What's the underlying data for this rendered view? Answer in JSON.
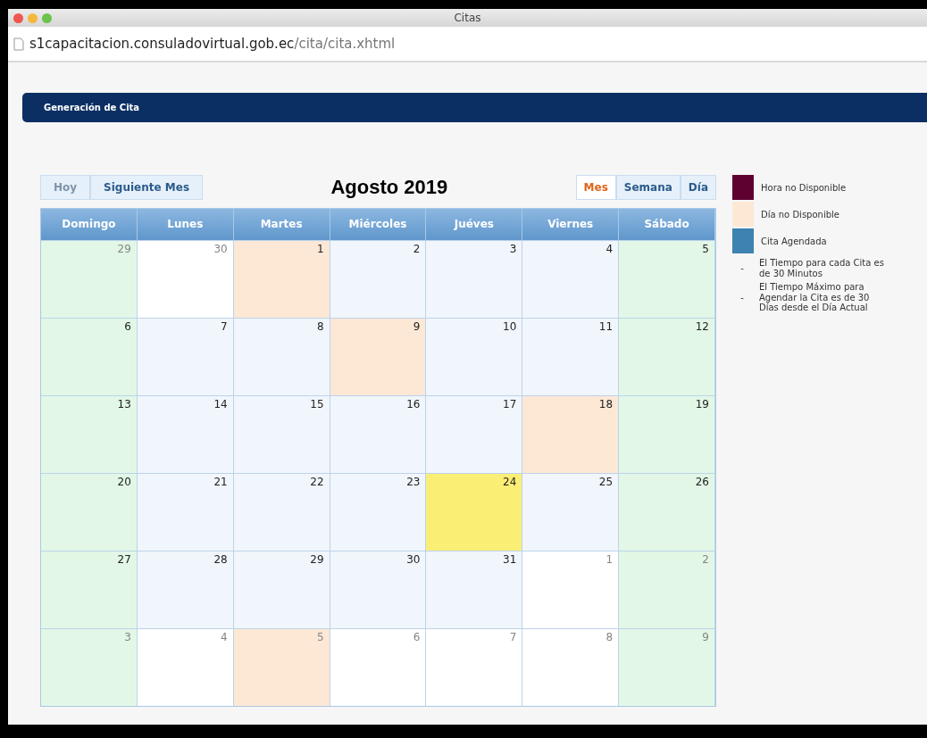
{
  "window": {
    "title": "Citas"
  },
  "address": {
    "host": "s1capacitacion.consuladovirtual.gob.ec",
    "path": "/cita/cita.xhtml"
  },
  "header": {
    "title": "Generación de Cita"
  },
  "toolbar": {
    "buttons": [
      {
        "label": "Hoy",
        "disabled": true
      },
      {
        "label": "Siguiente Mes",
        "disabled": false
      }
    ],
    "month_title": "Agosto 2019",
    "views": [
      {
        "label": "Mes",
        "selected": true
      },
      {
        "label": "Semana",
        "selected": false
      },
      {
        "label": "Día",
        "selected": false
      }
    ]
  },
  "calendar": {
    "weekdays": [
      "Domingo",
      "Lunes",
      "Martes",
      "Miércoles",
      "Juéves",
      "Viernes",
      "Sábado"
    ],
    "weeks": [
      [
        {
          "day": "29",
          "kind": "weekend",
          "other_month": true
        },
        {
          "day": "30",
          "kind": "blank",
          "other_month": true
        },
        {
          "day": "1",
          "kind": "unavailable",
          "other_month": false
        },
        {
          "day": "2",
          "kind": "free",
          "other_month": false
        },
        {
          "day": "3",
          "kind": "free",
          "other_month": false
        },
        {
          "day": "4",
          "kind": "free",
          "other_month": false
        },
        {
          "day": "5",
          "kind": "weekend",
          "other_month": false
        }
      ],
      [
        {
          "day": "6",
          "kind": "weekend",
          "other_month": false
        },
        {
          "day": "7",
          "kind": "free",
          "other_month": false
        },
        {
          "day": "8",
          "kind": "free",
          "other_month": false
        },
        {
          "day": "9",
          "kind": "unavailable",
          "other_month": false
        },
        {
          "day": "10",
          "kind": "free",
          "other_month": false
        },
        {
          "day": "11",
          "kind": "free",
          "other_month": false
        },
        {
          "day": "12",
          "kind": "weekend",
          "other_month": false
        }
      ],
      [
        {
          "day": "13",
          "kind": "weekend",
          "other_month": false
        },
        {
          "day": "14",
          "kind": "free",
          "other_month": false
        },
        {
          "day": "15",
          "kind": "free",
          "other_month": false
        },
        {
          "day": "16",
          "kind": "free",
          "other_month": false
        },
        {
          "day": "17",
          "kind": "free",
          "other_month": false
        },
        {
          "day": "18",
          "kind": "unavailable",
          "other_month": false
        },
        {
          "day": "19",
          "kind": "weekend",
          "other_month": false
        }
      ],
      [
        {
          "day": "20",
          "kind": "weekend",
          "other_month": false
        },
        {
          "day": "21",
          "kind": "free",
          "other_month": false
        },
        {
          "day": "22",
          "kind": "free",
          "other_month": false
        },
        {
          "day": "23",
          "kind": "free",
          "other_month": false
        },
        {
          "day": "24",
          "kind": "today",
          "other_month": false
        },
        {
          "day": "25",
          "kind": "free",
          "other_month": false
        },
        {
          "day": "26",
          "kind": "weekend",
          "other_month": false
        }
      ],
      [
        {
          "day": "27",
          "kind": "weekend",
          "other_month": false
        },
        {
          "day": "28",
          "kind": "free",
          "other_month": false
        },
        {
          "day": "29",
          "kind": "free",
          "other_month": false
        },
        {
          "day": "30",
          "kind": "free",
          "other_month": false
        },
        {
          "day": "31",
          "kind": "free",
          "other_month": false
        },
        {
          "day": "1",
          "kind": "blank",
          "other_month": true
        },
        {
          "day": "2",
          "kind": "weekend",
          "other_month": true
        }
      ],
      [
        {
          "day": "3",
          "kind": "weekend",
          "other_month": true
        },
        {
          "day": "4",
          "kind": "blank",
          "other_month": true
        },
        {
          "day": "5",
          "kind": "unavailable",
          "other_month": true
        },
        {
          "day": "6",
          "kind": "blank",
          "other_month": true
        },
        {
          "day": "7",
          "kind": "blank",
          "other_month": true
        },
        {
          "day": "8",
          "kind": "blank",
          "other_month": true
        },
        {
          "day": "9",
          "kind": "weekend",
          "other_month": true
        }
      ]
    ]
  },
  "legend": {
    "items": [
      {
        "label": "Hora no Disponible",
        "color": "#5e0030"
      },
      {
        "label": "Día no Disponible",
        "color": "#fde8d6"
      },
      {
        "label": "Cita Agendada",
        "color": "#3d82b0"
      }
    ],
    "notes": [
      {
        "bullet": "-",
        "text": "El Tiempo para cada Cita es de 30 Minutos"
      },
      {
        "bullet": "-",
        "text": "El Tiempo Máximo para Agendar la Cita es de 30 Días desde el Día Actual"
      }
    ]
  }
}
